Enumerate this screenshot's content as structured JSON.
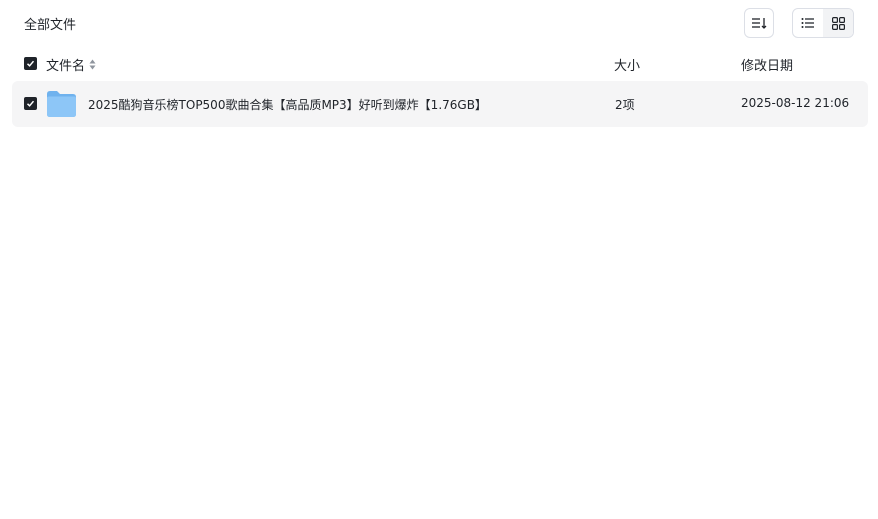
{
  "breadcrumb": {
    "label": "全部文件"
  },
  "toolbar": {
    "sort_icon": "sort-icon",
    "list_view_icon": "list-view-icon",
    "grid_view_icon": "grid-view-icon",
    "active_view": "list"
  },
  "table": {
    "columns": {
      "name": "文件名",
      "size": "大小",
      "modified": "修改日期"
    },
    "select_all_checked": true,
    "rows": [
      {
        "type": "folder",
        "checked": true,
        "name": "2025酷狗音乐榜TOP500歌曲合集【高品质MP3】好听到爆炸【1.76GB】",
        "size": "2项",
        "modified": "2025-08-12 21:06"
      }
    ]
  },
  "colors": {
    "checkbox": "#1f2329",
    "row_bg": "#f5f5f6",
    "folder": "#74b7f1"
  }
}
